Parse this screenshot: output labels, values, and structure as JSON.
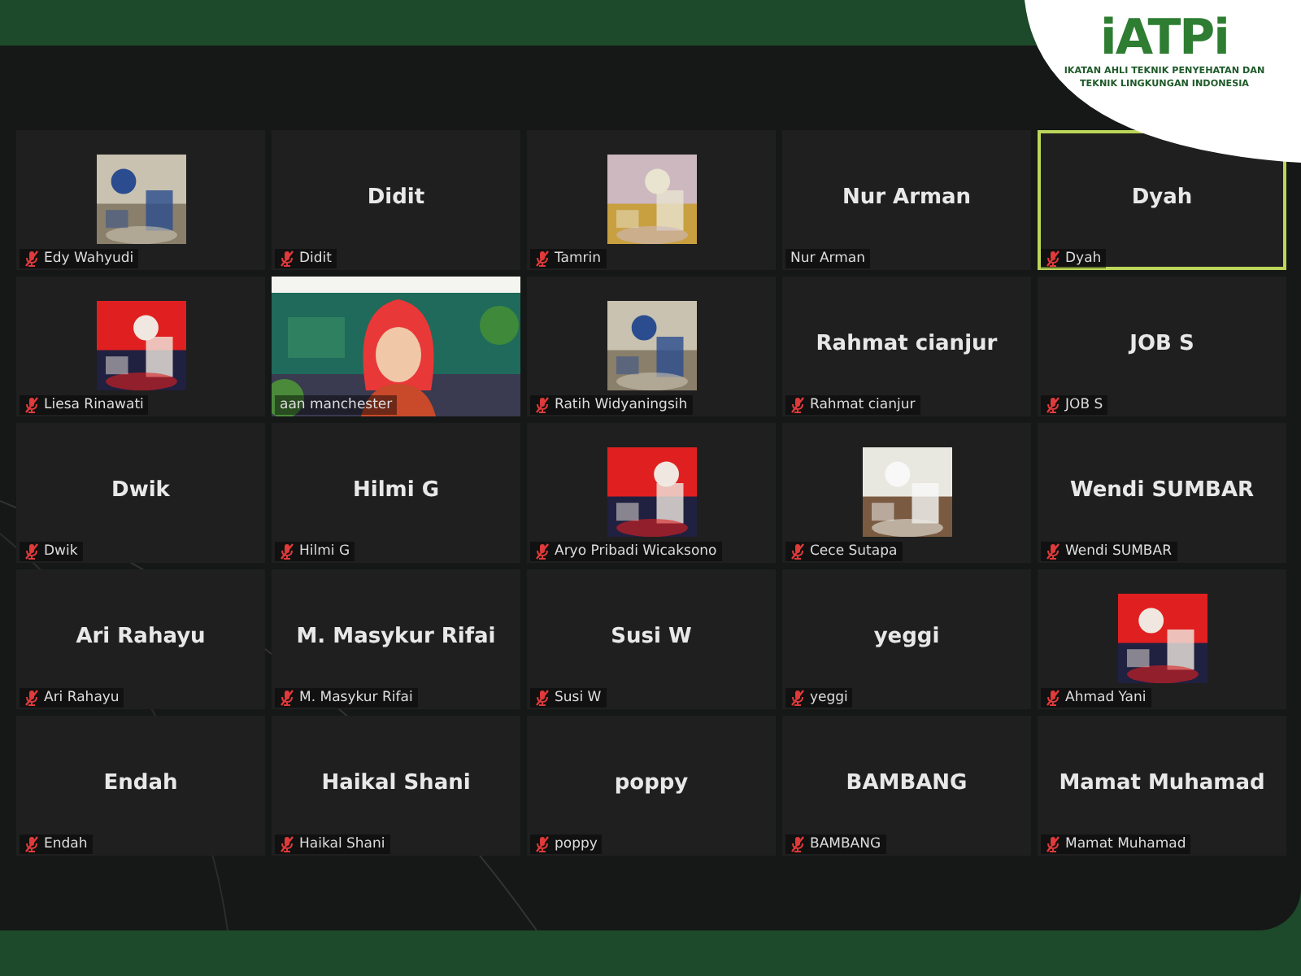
{
  "logo": {
    "mark": "iATPi",
    "subtitle_lines": [
      "IKATAN AHLI TEKNIK PENYEHATAN DAN",
      "TEKNIK LINGKUNGAN INDONESIA"
    ]
  },
  "tiles": [
    {
      "kind": "picture",
      "label": "Edy Wahyudi",
      "muted": true,
      "selected": false
    },
    {
      "kind": "name",
      "display": "Didit",
      "label": "Didit",
      "muted": true,
      "selected": false
    },
    {
      "kind": "picture",
      "label": "Tamrin",
      "muted": true,
      "selected": false
    },
    {
      "kind": "name",
      "display": "Nur Arman",
      "label": "Nur Arman",
      "muted": false,
      "selected": false
    },
    {
      "kind": "name",
      "display": "Dyah",
      "label": "Dyah",
      "muted": true,
      "selected": true
    },
    {
      "kind": "picture",
      "label": "Liesa Rinawati",
      "muted": true,
      "selected": false
    },
    {
      "kind": "video",
      "label": "aan manchester",
      "muted": false,
      "selected": false
    },
    {
      "kind": "picture",
      "label": "Ratih Widyaningsih",
      "muted": true,
      "selected": false
    },
    {
      "kind": "name",
      "display": "Rahmat cianjur",
      "label": "Rahmat cianjur",
      "muted": true,
      "selected": false
    },
    {
      "kind": "name",
      "display": "JOB S",
      "label": "JOB S",
      "muted": true,
      "selected": false
    },
    {
      "kind": "name",
      "display": "Dwik",
      "label": "Dwik",
      "muted": true,
      "selected": false
    },
    {
      "kind": "name",
      "display": "Hilmi G",
      "label": "Hilmi G",
      "muted": true,
      "selected": false
    },
    {
      "kind": "picture",
      "label": "Aryo Pribadi Wicaksono",
      "muted": true,
      "selected": false
    },
    {
      "kind": "picture",
      "label": "Cece Sutapa",
      "muted": true,
      "selected": false
    },
    {
      "kind": "name",
      "display": "Wendi SUMBAR",
      "label": "Wendi SUMBAR",
      "muted": true,
      "selected": false
    },
    {
      "kind": "name",
      "display": "Ari Rahayu",
      "label": "Ari Rahayu",
      "muted": true,
      "selected": false
    },
    {
      "kind": "name",
      "display": "M. Masykur Rifai",
      "label": "M. Masykur Rifai",
      "muted": true,
      "selected": false
    },
    {
      "kind": "name",
      "display": "Susi W",
      "label": "Susi W",
      "muted": true,
      "selected": false
    },
    {
      "kind": "name",
      "display": "yeggi",
      "label": "yeggi",
      "muted": true,
      "selected": false
    },
    {
      "kind": "picture",
      "label": "Ahmad Yani",
      "muted": true,
      "selected": false
    },
    {
      "kind": "name",
      "display": "Endah",
      "label": "Endah",
      "muted": true,
      "selected": false
    },
    {
      "kind": "name",
      "display": "Haikal Shani",
      "label": "Haikal Shani",
      "muted": true,
      "selected": false
    },
    {
      "kind": "name",
      "display": "poppy",
      "label": "poppy",
      "muted": true,
      "selected": false
    },
    {
      "kind": "name",
      "display": "BAMBANG",
      "label": "BAMBANG",
      "muted": true,
      "selected": false
    },
    {
      "kind": "name",
      "display": "Mamat Muhamad",
      "label": "Mamat Muhamad",
      "muted": true,
      "selected": false
    }
  ]
}
